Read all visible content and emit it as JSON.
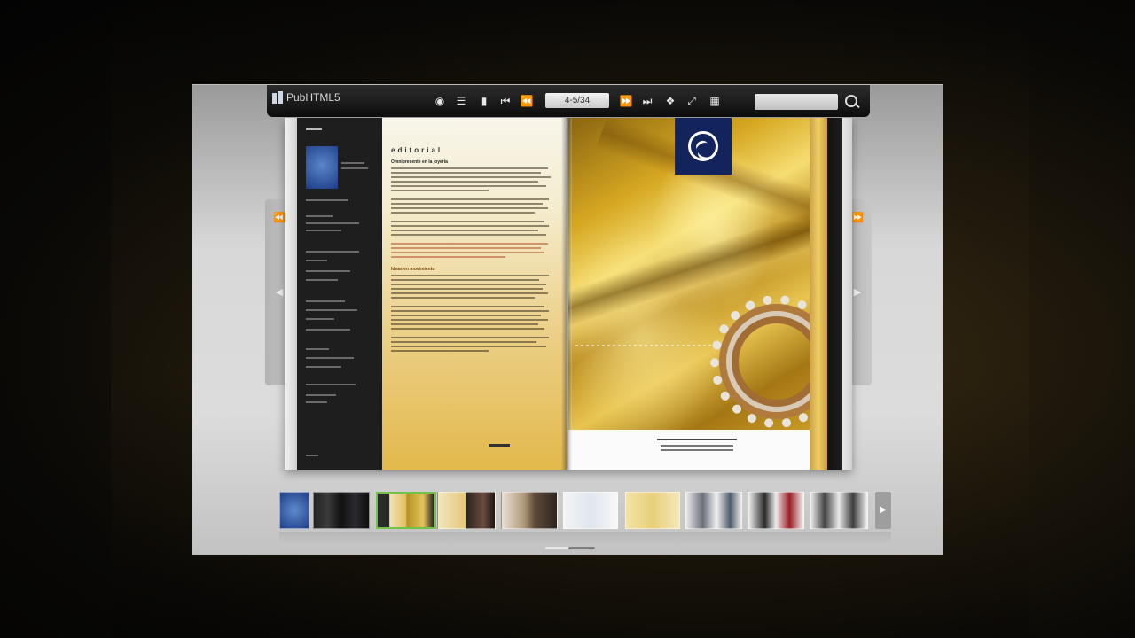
{
  "app": {
    "brand": "PubHTML5"
  },
  "toolbar": {
    "page_indicator": "4-5/34",
    "search_placeholder": "",
    "icons": [
      "print-icon",
      "table-of-contents-icon",
      "bookmark-icon",
      "first-page-icon",
      "previous-page-icon",
      "next-page-icon",
      "last-page-icon",
      "share-icon",
      "fullscreen-icon",
      "thumbnails-icon",
      "search-icon"
    ]
  },
  "left_page": {
    "heading": "editorial",
    "subheading": "Omnipresente en la joyería",
    "section_title": "Ideas en movimiento"
  },
  "thumbnails": {
    "count": 11,
    "active_index": 2
  },
  "colors": {
    "viewer_bg": "#d8d8d8",
    "toolbar_bg": "#151515",
    "active_thumb_border": "#74c04a",
    "logo_blue": "#13235c",
    "gold": "#d6a822"
  }
}
